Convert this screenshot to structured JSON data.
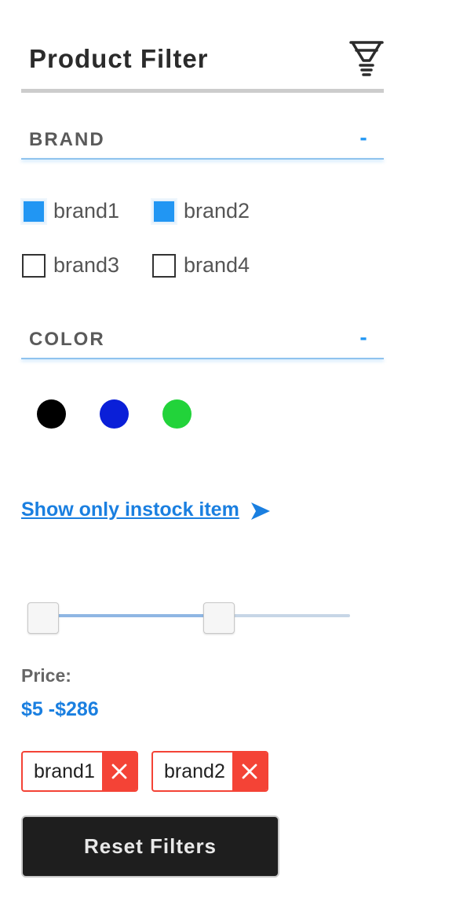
{
  "header": {
    "title": "Product Filter",
    "icon": "funnel-icon"
  },
  "brand_section": {
    "title": "BRAND",
    "toggle": "-",
    "options": [
      {
        "label": "brand1",
        "checked": true
      },
      {
        "label": "brand2",
        "checked": true
      },
      {
        "label": "brand3",
        "checked": false
      },
      {
        "label": "brand4",
        "checked": false
      }
    ]
  },
  "color_section": {
    "title": "COLOR",
    "toggle": "-",
    "swatches": [
      "#000000",
      "#0a1fd8",
      "#22d33a"
    ]
  },
  "instock": {
    "label": "Show only instock item",
    "icon": "arrow-right-icon"
  },
  "price": {
    "label": "Price:",
    "range_text": "$5 -$286",
    "min": 5,
    "max": 286
  },
  "active_filters": [
    {
      "label": "brand1",
      "remove_icon": "close-icon"
    },
    {
      "label": "brand2",
      "remove_icon": "close-icon"
    }
  ],
  "reset_button": {
    "label": "Reset Filters"
  },
  "colors": {
    "accent": "#2196f3",
    "link": "#1a7fe0",
    "danger": "#f44336",
    "button_bg": "#1e1e1e"
  }
}
